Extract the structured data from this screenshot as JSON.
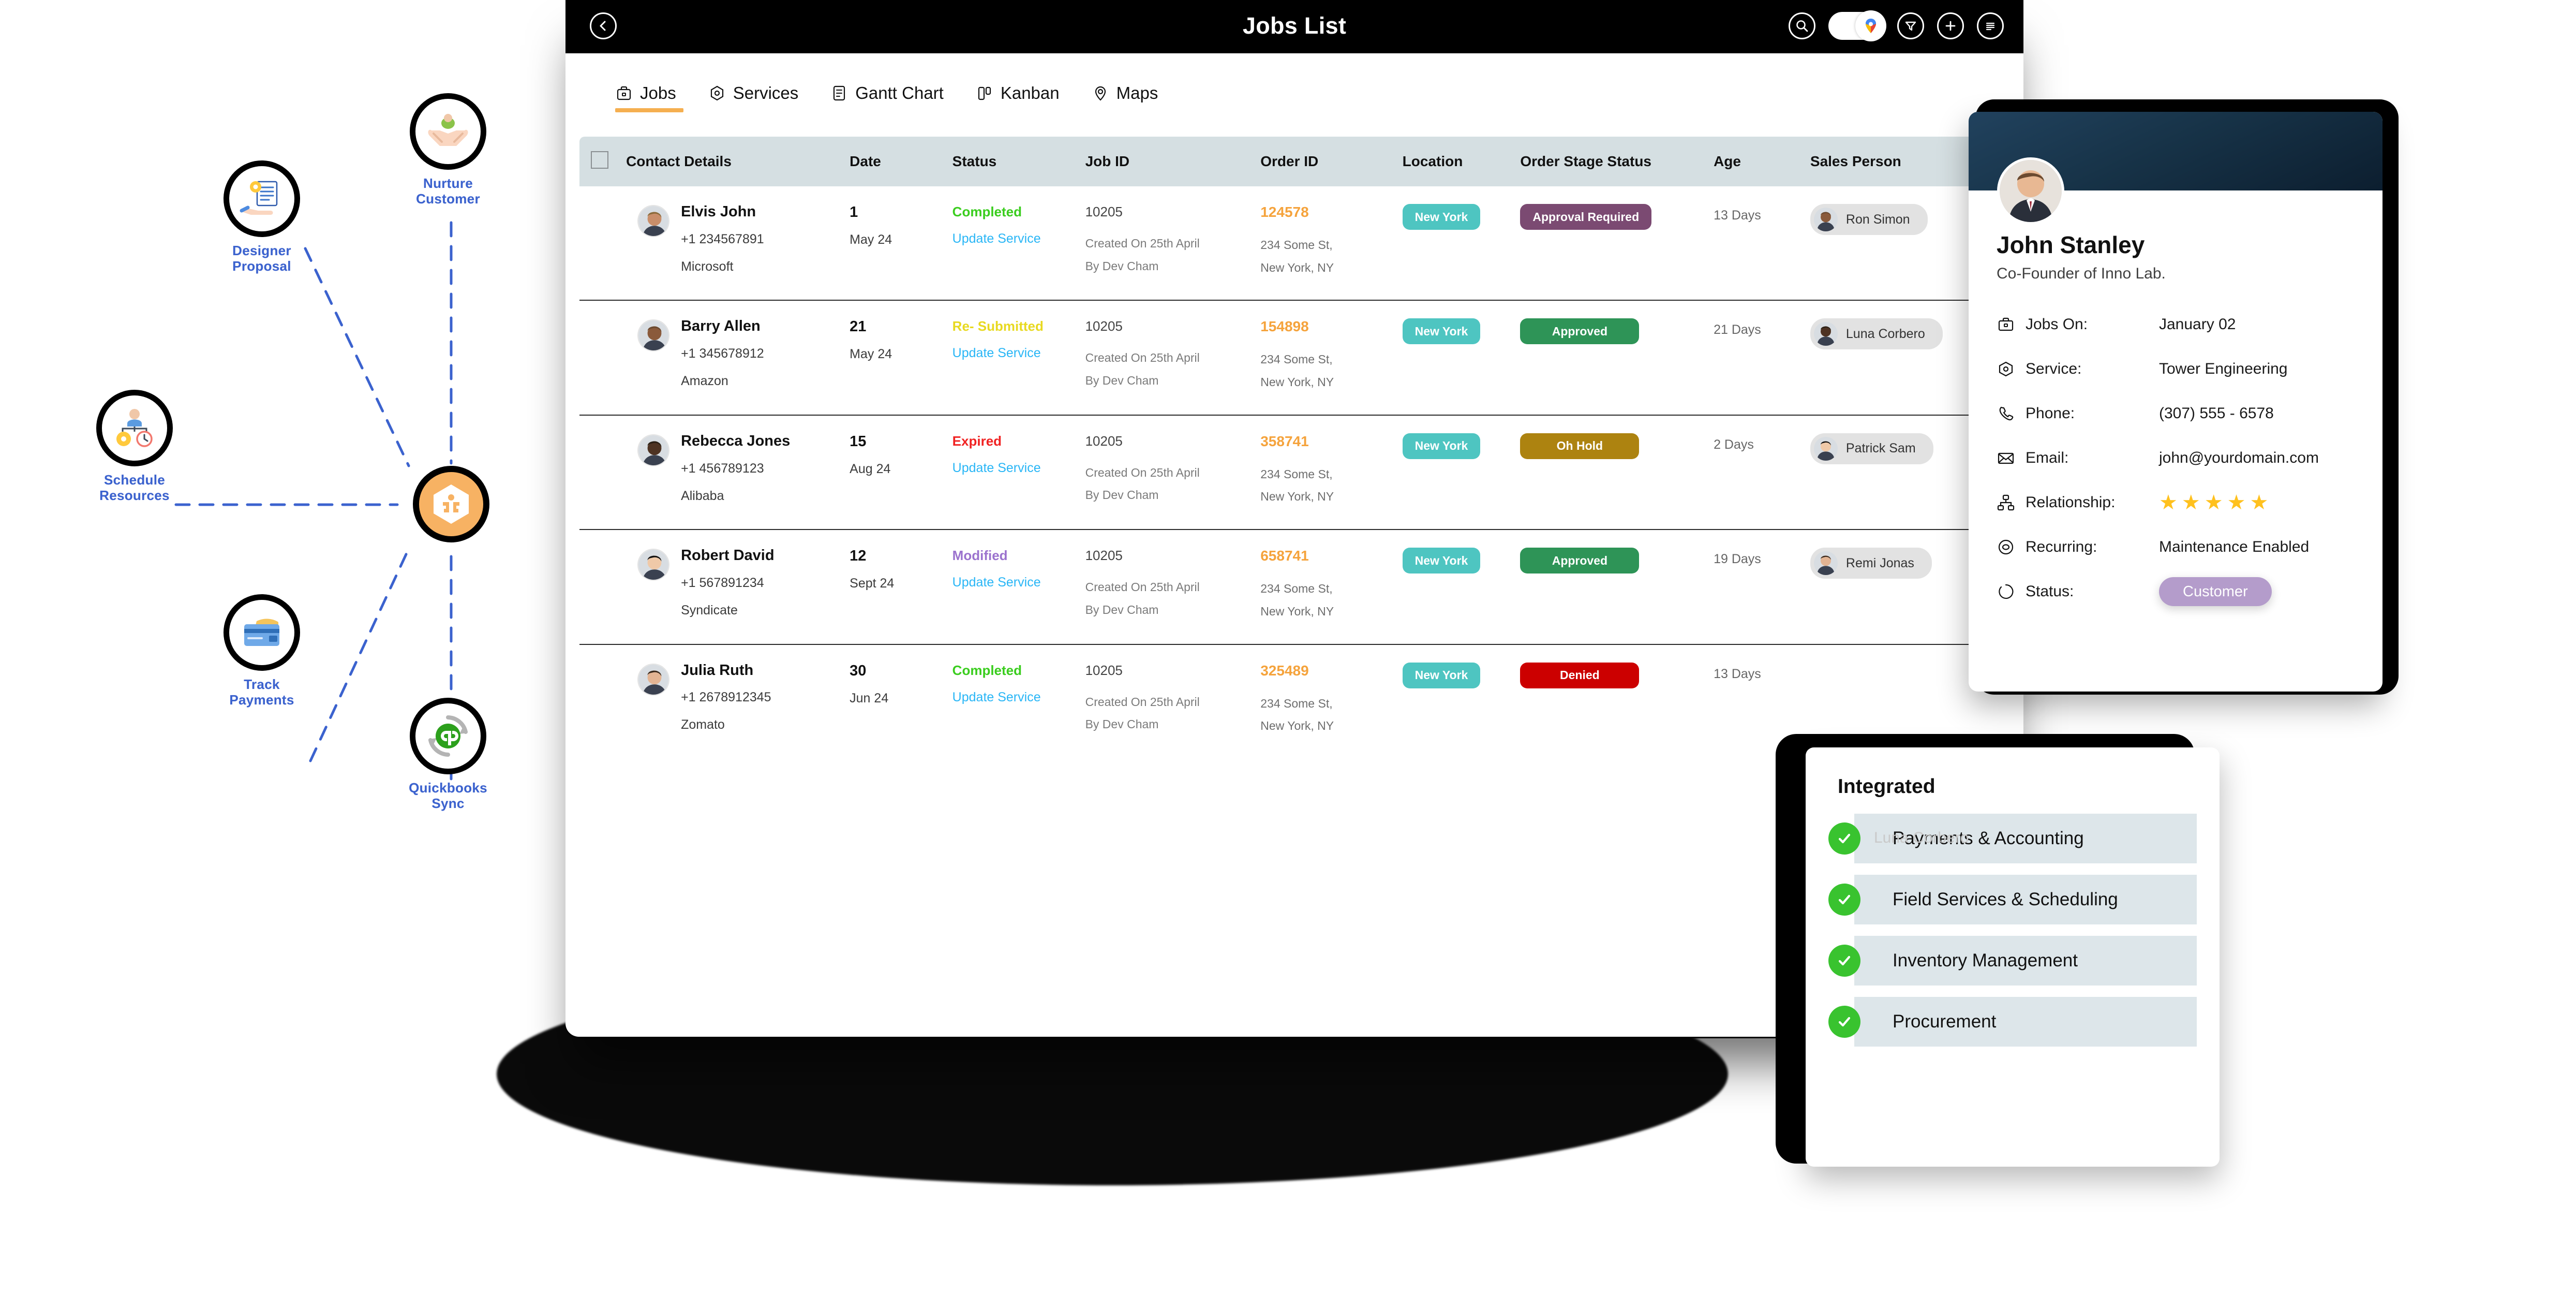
{
  "flow": {
    "nodes": [
      {
        "id": "nurture",
        "label": "Nurture\nCustomer",
        "icon": "nurture-hands-icon"
      },
      {
        "id": "proposal",
        "label": "Designer\nProposal",
        "icon": "proposal-hand-document-icon"
      },
      {
        "id": "schedule",
        "label": "Schedule\nResources",
        "icon": "schedule-resources-icon"
      },
      {
        "id": "payments",
        "label": "Track\nPayments",
        "icon": "credit-card-icon"
      },
      {
        "id": "quickbooks",
        "label": "Quickbooks\nSync",
        "icon": "quickbooks-sync-icon"
      },
      {
        "id": "center",
        "label": "",
        "icon": "jobcard-hexagon-logo"
      }
    ],
    "link_color": "#3B62CE",
    "label_color": "#3B62CE",
    "center_color": "#F7B263"
  },
  "topbar": {
    "back_label": "‹",
    "title": "Jobs List",
    "actions": [
      {
        "name": "search-icon",
        "label": "Search"
      },
      {
        "name": "map-toggle",
        "label": "Map view"
      },
      {
        "name": "filter-icon",
        "label": "Filter"
      },
      {
        "name": "add-icon",
        "label": "Add"
      },
      {
        "name": "list-menu-icon",
        "label": "List options"
      }
    ]
  },
  "tabs": [
    {
      "label": "Jobs",
      "icon": "briefcase-icon",
      "active": true
    },
    {
      "label": "Services",
      "icon": "hexagon-gear-icon",
      "active": false
    },
    {
      "label": "Gantt Chart",
      "icon": "document-list-icon",
      "active": false
    },
    {
      "label": "Kanban",
      "icon": "kanban-columns-icon",
      "active": false
    },
    {
      "label": "Maps",
      "icon": "map-pin-icon",
      "active": false
    }
  ],
  "table": {
    "header_bg": "#D5DFE2",
    "columns": [
      "",
      "Contact Details",
      "Date",
      "Status",
      "Job ID",
      "Order ID",
      "Location",
      "Order Stage Status",
      "Age",
      "Sales Person"
    ],
    "rows": [
      {
        "name": "Elvis John",
        "phone": "+1 234567891",
        "company": "Microsoft",
        "date_num": "1",
        "date_month": "May 24",
        "status": "Completed",
        "status_color": "#3ACD1E",
        "update_label": "Update Service",
        "job_id": "10205",
        "job_created": "Created On 25th April",
        "job_by": "By Dev Cham",
        "order_id": "124578",
        "order_addr1": "234 Some St,",
        "order_addr2": "New York, NY",
        "location": "New York",
        "stage": "Approval Required",
        "stage_color": "#7B4A72",
        "age": "13 Days",
        "sales_person": "Ron Simon",
        "sales_avatar": "#6b6257"
      },
      {
        "name": "Barry Allen",
        "phone": "+1 345678912",
        "company": "Amazon",
        "date_num": "21",
        "date_month": "May 24",
        "status": "Re- Submitted",
        "status_color": "#E8D920",
        "update_label": "Update Service",
        "job_id": "10205",
        "job_created": "Created On 25th April",
        "job_by": "By Dev Cham",
        "order_id": "154898",
        "order_addr1": "234 Some St,",
        "order_addr2": "New York, NY",
        "location": "New York",
        "stage": "Approved",
        "stage_color": "#2E9457",
        "age": "21 Days",
        "sales_person": "Luna Corbero",
        "sales_avatar": "#c9a394"
      },
      {
        "name": "Rebecca Jones",
        "phone": "+1 456789123",
        "company": "Alibaba",
        "date_num": "15",
        "date_month": "Aug 24",
        "status": "Expired",
        "status_color": "#F02222",
        "update_label": "Update Service",
        "job_id": "10205",
        "job_created": "Created On 25th April",
        "job_by": "By Dev Cham",
        "order_id": "358741",
        "order_addr1": "234 Some St,",
        "order_addr2": "New York, NY",
        "location": "New York",
        "stage": "Oh Hold",
        "stage_color": "#AD8310",
        "age": "2 Days",
        "sales_person": "Patrick Sam",
        "sales_avatar": "#4a332a"
      },
      {
        "name": "Robert David",
        "phone": "+1 567891234",
        "company": "Syndicate",
        "date_num": "12",
        "date_month": "Sept 24",
        "status": "Modified",
        "status_color": "#9B72CE",
        "update_label": "Update Service",
        "job_id": "10205",
        "job_created": "Created On 25th April",
        "job_by": "By Dev Cham",
        "order_id": "658741",
        "order_addr1": "234 Some St,",
        "order_addr2": "New York, NY",
        "location": "New York",
        "stage": "Approved",
        "stage_color": "#2E9457",
        "age": "19 Days",
        "sales_person": "Remi Jonas",
        "sales_avatar": "#8d5347"
      },
      {
        "name": "Julia Ruth",
        "phone": "+1 2678912345",
        "company": "Zomato",
        "date_num": "30",
        "date_month": "Jun 24",
        "status": "Completed",
        "status_color": "#3ACD1E",
        "update_label": "Update Service",
        "job_id": "10205",
        "job_created": "Created On 25th April",
        "job_by": "By Dev Cham",
        "order_id": "325489",
        "order_addr1": "234 Some St,",
        "order_addr2": "New York, NY",
        "location": "New York",
        "stage": "Denied",
        "stage_color": "#CC0000",
        "age": "13 Days",
        "sales_person": "",
        "sales_avatar": "#999999"
      }
    ]
  },
  "contact_card": {
    "name": "John Stanley",
    "role": "Co-Founder of Inno Lab.",
    "rows": [
      {
        "icon": "briefcase-icon",
        "key": "Jobs On:",
        "value": "January 02"
      },
      {
        "icon": "hexagon-gear-icon",
        "key": "Service:",
        "value": "Tower Engineering"
      },
      {
        "icon": "phone-icon",
        "key": "Phone:",
        "value": "(307) 555 - 6578"
      },
      {
        "icon": "envelope-icon",
        "key": "Email:",
        "value": "john@yourdomain.com"
      },
      {
        "icon": "org-chart-icon",
        "key": "Relationship:",
        "value": ""
      },
      {
        "icon": "recurring-icon",
        "key": "Recurring:",
        "value": "Maintenance Enabled"
      },
      {
        "icon": "status-circle-icon",
        "key": "Status:",
        "value": ""
      }
    ],
    "rating": 5,
    "rating_color": "#FFC11E",
    "status_badge": "Customer",
    "status_badge_color": "#B49CCB"
  },
  "integrated": {
    "title": "Integrated",
    "ghost_text": "Luna Corbero",
    "check_color": "#39C32F",
    "items": [
      {
        "label": "Payments & Accounting"
      },
      {
        "label": "Field Services & Scheduling"
      },
      {
        "label": "Inventory Management"
      },
      {
        "label": "Procurement"
      }
    ]
  }
}
